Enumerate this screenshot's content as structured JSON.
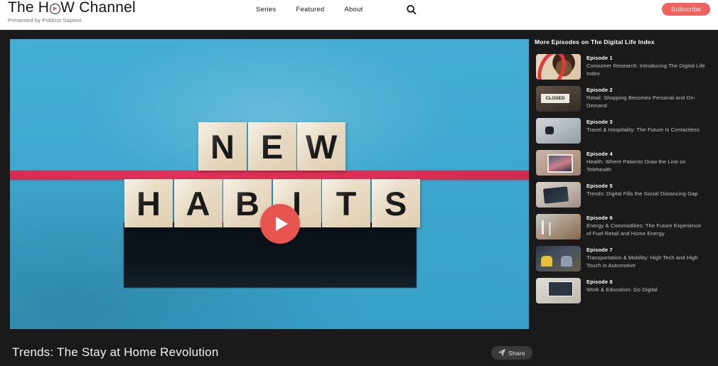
{
  "header": {
    "brand": {
      "text_the": "The",
      "text_h": "H",
      "logo_icon": "play-circle-icon",
      "text_w": "W",
      "text_channel": "Channel",
      "subtitle": "Presented by Publicis Sapient"
    },
    "nav": [
      {
        "label": "Series"
      },
      {
        "label": "Featured"
      },
      {
        "label": "About"
      }
    ],
    "search_icon": "search-icon",
    "subscribe_label": "Subscribe",
    "accent_color": "#f0625f",
    "background_color": "#ffffff"
  },
  "player": {
    "play_icon": "play-button-icon",
    "poster_alt": "NEW HABITS wooden letter tiles on blue background with red stripe",
    "poster_line1": "NEW",
    "poster_line2": "HABITS",
    "poster_bg_color": "#3fa9d1",
    "poster_stripe_color": "#dc3055",
    "play_button_color": "#e8554e"
  },
  "video": {
    "title": "Trends: The Stay at Home Revolution",
    "share_label": "Share",
    "share_icon": "send-icon"
  },
  "sidebar": {
    "title": "More Episodes on The Digital Life Index",
    "episodes": [
      {
        "number": "Episode 1",
        "description": "Consumer Research: Introducing The Digital Life Index",
        "thumb": "woman-smiling-thumbnail"
      },
      {
        "number": "Episode 2",
        "description": "Retail: Shopping Becomes Personal and On-Demand",
        "thumb": "closed-sign-thumbnail"
      },
      {
        "number": "Episode 3",
        "description": "Travel & Hospitality: The Future Is Contactless",
        "thumb": "smartwatch-thumbnail"
      },
      {
        "number": "Episode 4",
        "description": "Health: Where Patients Draw the Line on Telehealth",
        "thumb": "telehealth-laptop-thumbnail"
      },
      {
        "number": "Episode 5",
        "description": "Trends: Digital Fills the Social Distancing Gap",
        "thumb": "tablet-device-thumbnail"
      },
      {
        "number": "Episode 6",
        "description": "Energy & Commodities: The Future Experience of Fuel Retail and Home Energy",
        "thumb": "wind-turbine-thumbnail"
      },
      {
        "number": "Episode 7",
        "description": "Transportation & Mobility: High Tech and High Touch in Automotive",
        "thumb": "car-passengers-thumbnail"
      },
      {
        "number": "Episode 8",
        "description": "Work & Education: Go Digital",
        "thumb": "video-conference-thumbnail"
      }
    ]
  }
}
